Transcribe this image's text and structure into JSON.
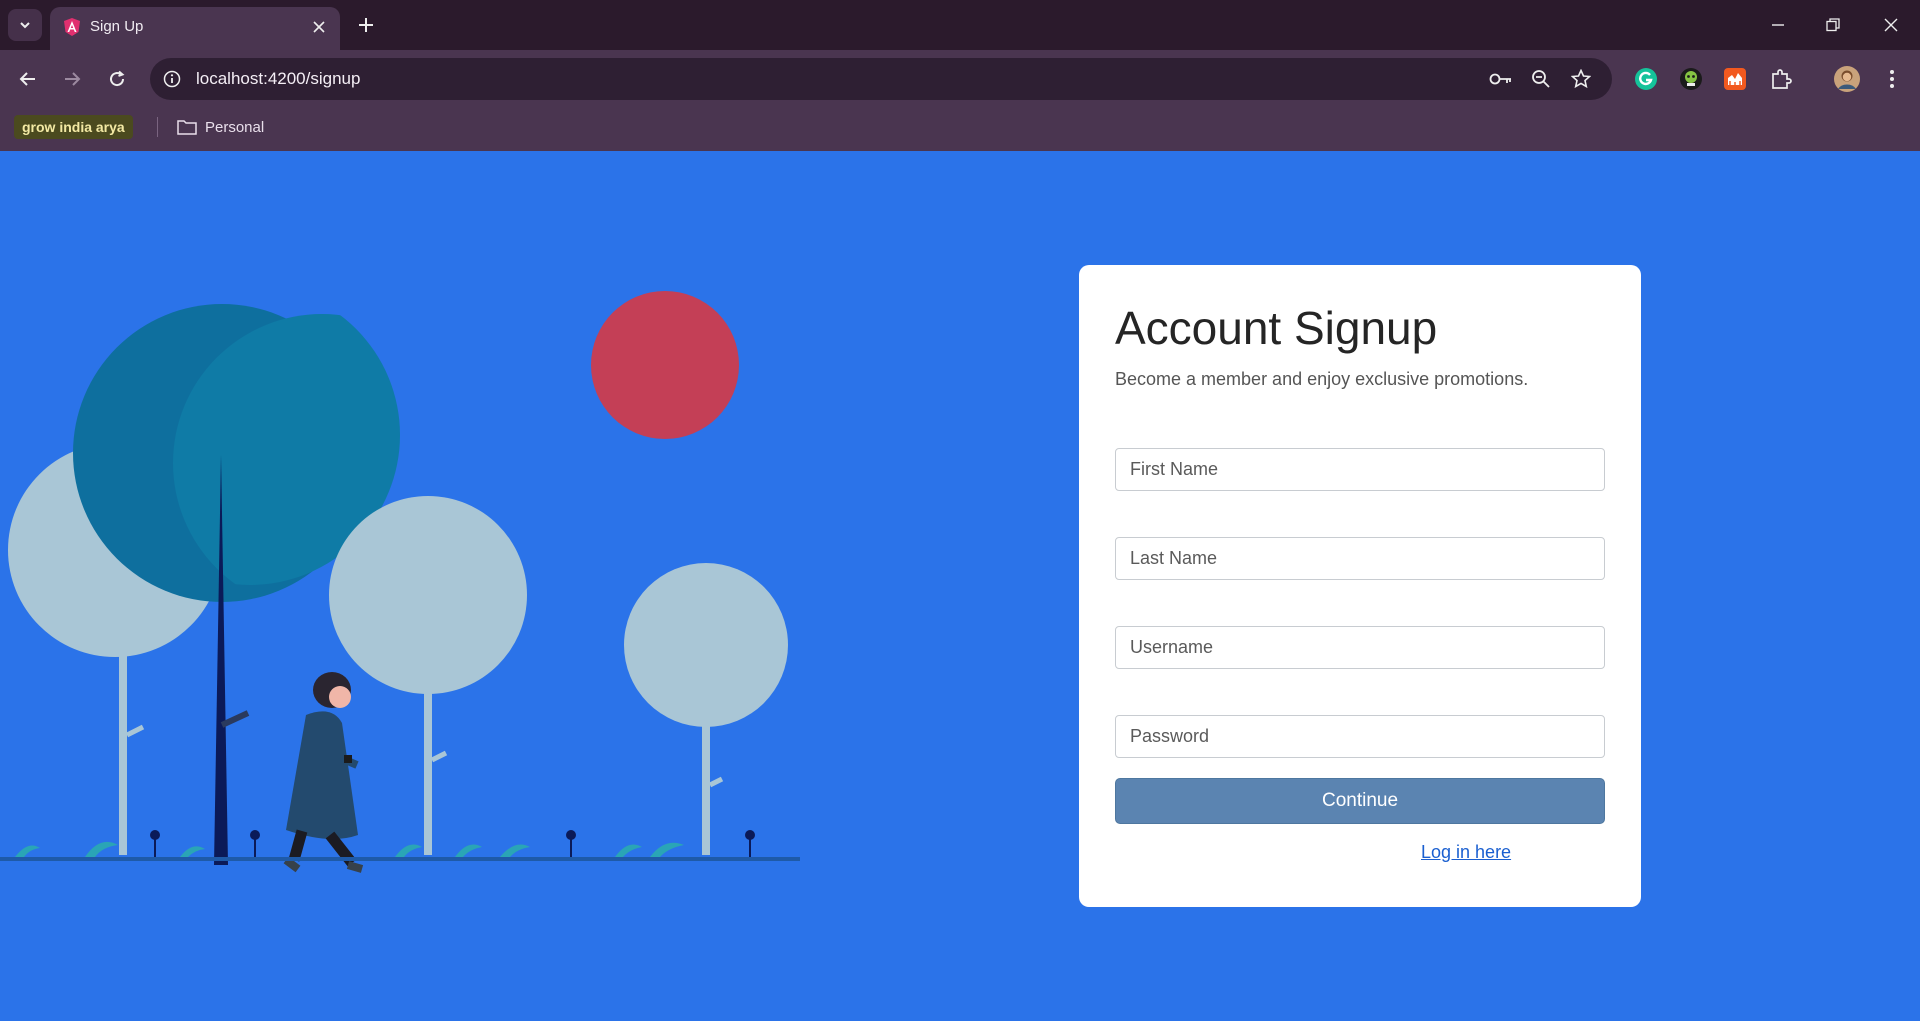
{
  "browser": {
    "tab": {
      "title": "Sign Up"
    },
    "omnibox": {
      "url": "localhost:4200/signup"
    },
    "bookmarks": {
      "badge": "grow india arya",
      "folder": "Personal"
    }
  },
  "signup": {
    "title": "Account Signup",
    "subtitle": "Become a member and enjoy exclusive promotions.",
    "fields": {
      "first_name_placeholder": "First Name",
      "last_name_placeholder": "Last Name",
      "username_placeholder": "Username",
      "password_placeholder": "Password"
    },
    "continue_label": "Continue",
    "login_link": "Log in here"
  },
  "colors": {
    "page_background": "#2b73e9",
    "continue_button": "#5b84b1",
    "chrome_dark": "#2b1a2c",
    "chrome_toolbar": "#4a3550"
  }
}
